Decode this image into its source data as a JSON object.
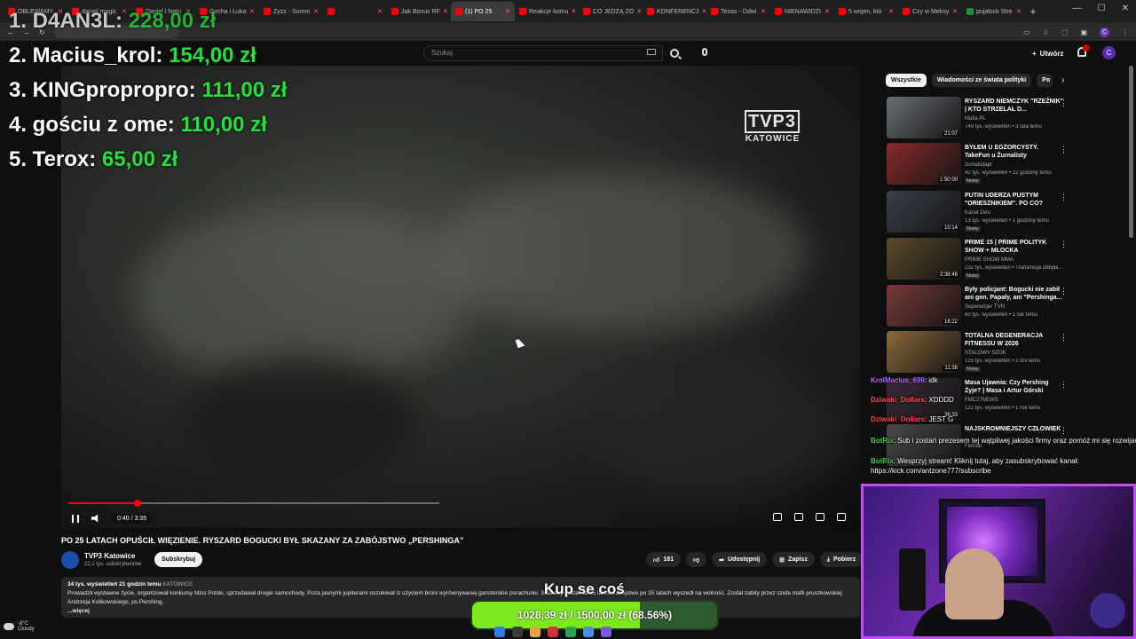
{
  "browser": {
    "tabs": [
      {
        "label": "OBLEWAMY",
        "active": false
      },
      {
        "label": "daniel magic",
        "active": false
      },
      {
        "label": "Daniel i Natu",
        "active": false
      },
      {
        "label": "Gocha i Łuka",
        "active": false
      },
      {
        "label": "Zyzz - Summ",
        "active": false
      },
      {
        "label": "",
        "active": false
      },
      {
        "label": "Jak Bonus RF",
        "active": false
      },
      {
        "label": "(1) PO 25",
        "active": true
      },
      {
        "label": "Reakcje komu",
        "active": false
      },
      {
        "label": "CO JEDZĄ ZO",
        "active": false
      },
      {
        "label": "KONFERENCJ",
        "active": false
      },
      {
        "label": "Texas - Odwi",
        "active": false
      },
      {
        "label": "NIENAWIDZI",
        "active": false
      },
      {
        "label": "5 wojen, któ",
        "active": false
      },
      {
        "label": "Czy w Meksy",
        "active": false
      },
      {
        "label": "pujalock Stre",
        "active": false
      }
    ],
    "profile_initial": "C"
  },
  "youtube": {
    "search_placeholder": "Szukaj",
    "create_label": "Utwórz",
    "avatar_initial": "C"
  },
  "player": {
    "channel_logo": "TVP3",
    "channel_city": "KATOWICE",
    "current_time": "0:40",
    "duration": "3:35",
    "time_display": "0:40 / 3:35",
    "progress_fraction": 0.186
  },
  "video": {
    "title": "PO 25 LATACH OPUŚCIŁ WIĘZIENIE. RYSZARD BOGUCKI BYŁ SKAZANY ZA ZABÓJSTWO „PERSHINGA”",
    "channel": "TVP3 Katowice",
    "subscribers": "22,1 tys. subskrybentów",
    "subscribe_label": "Subskrybuj",
    "likes": "181",
    "share_label": "Udostępnij",
    "save_label": "Zapisz",
    "download_label": "Pobierz",
    "views_date": "34 tys. wyświetleń  21 godzin temu",
    "location_tag": "KATOWICE",
    "description_line1": "Prowadził wystawne życie, organizował konkursy Miss Polski, sprzedawał drogie samochody. Poza jasnymi jupiterami oszukiwał iz użyciem broni wyrównywanej gansterskie porachunki. Skazany został na 25 lat za zabójstwo po 25 latach wyszedł na wolność. Został zabity przez szefa mafii pruszkowskiej",
    "description_line2": "Andrzeja Kolikowskiego, ps.Pershing.",
    "more_label": "...więcej"
  },
  "sidebar": {
    "chips": [
      "Wszystkie",
      "Wiadomości ze świata polityki",
      "Po"
    ],
    "recommended": [
      {
        "title": "RYSZARD NIEMCZYK \"RZEŹNIK\" | KTO STRZELAŁ D...",
        "channel": "Mafia PL",
        "meta": "749 tys. wyświetleń • 3 lata temu",
        "duration": "21:07",
        "is_new": false
      },
      {
        "title": "BYŁEM U EGZORCYSTY. TakeFun u Żurnalisty",
        "channel": "żurnalistapl",
        "meta": "42 tys. wyświetleń • 22 godziny temu",
        "duration": "1:50:00",
        "is_new": true
      },
      {
        "title": "PUTIN UDERZA PUSTYM \"ORIESZNIKIEM\". PO CO?",
        "channel": "Kanał Zero",
        "meta": "13 tys. wyświetleń • 1 godzinę temu",
        "duration": "10:14",
        "is_new": true
      },
      {
        "title": "PRIME 15 | PRIME POLITYK SHOW + MŁOCKA",
        "channel": "PRIME SHOW MMA",
        "meta": "232 tys. wyświetleń • Transmisja odbyła...",
        "duration": "2:38:46",
        "is_new": true
      },
      {
        "title": "Były policjant: Bogucki nie zabił ani gen. Papały, ani \"Pershinga...",
        "channel": "Superwizjer TVN",
        "meta": "60 tys. wyświetleń • 1 rok temu",
        "duration": "16:22",
        "is_new": false
      },
      {
        "title": "TOTALNA DEGENERACJA FITNESSU W 2026",
        "channel": "STALOWY SZOK",
        "meta": "125 tys. wyświetleń • 2 dni temu",
        "duration": "11:38",
        "is_new": true
      },
      {
        "title": "Masa Ujawnia: Czy Pershing Żyje? | Masa i Artur Górski",
        "channel": "FMC27NEWS",
        "meta": "122 tys. wyświetleń • 1 rok temu",
        "duration": "36:33",
        "is_new": false
      },
      {
        "title": "NAJSKROMNIEJSZY CZŁOWIEK",
        "channel": "Fermat",
        "meta": "",
        "duration": "",
        "is_new": false
      }
    ]
  },
  "overlay": {
    "leaderboard": [
      {
        "rank_name": "1. D4AN3L:",
        "amount": "228,00 zł"
      },
      {
        "rank_name": "2. Macius_krol:",
        "amount": "154,00 zł"
      },
      {
        "rank_name": "3. KINGpropropro:",
        "amount": "111,00 zł"
      },
      {
        "rank_name": "4. gościu z ome:",
        "amount": "110,00 zł"
      },
      {
        "rank_name": "5. Terox:",
        "amount": "65,00 zł"
      }
    ],
    "chat": [
      {
        "user": "KrolMacius_699",
        "text": "idk",
        "color": "#b36bff"
      },
      {
        "user": "Dziwaki_Dollars",
        "text": "XDDDD",
        "color": "#ff4d4d"
      },
      {
        "user": "Dziwaki_Dollars",
        "text": "JEST G",
        "color": "#ff4d4d"
      },
      {
        "user": "BotRix",
        "text": "Sub i zostań prezesem tej wątpliwej jakości firmy oraz pomóż mi się rozwijać",
        "color": "#37d24a"
      },
      {
        "user": "BotRix",
        "text": "Wesprzyj stream! Kliknij tutaj, aby zasubskrybować kanał: https://kick.com/antzone777/subscribe",
        "color": "#37d24a"
      }
    ],
    "goal_title": "Kup se coś",
    "goal_current": "1028,39 zł",
    "goal_target": "1500,00 zł",
    "goal_percent": "(68.56%)",
    "goal_fraction": 0.6856
  },
  "taskbar": {
    "temperature": "-8°C",
    "weather": "Cloudy"
  }
}
